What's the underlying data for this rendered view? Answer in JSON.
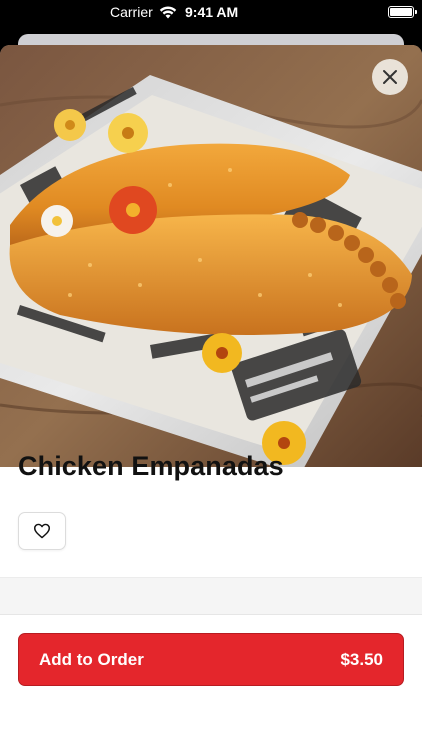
{
  "status_bar": {
    "carrier": "Carrier",
    "time": "9:41 AM"
  },
  "item": {
    "name": "Chicken Empanadas",
    "price": "$3.50",
    "image_icon": "empanada-photo"
  },
  "actions": {
    "add_to_order_label": "Add to Order",
    "favorite_icon": "heart-icon",
    "close_icon": "close-icon"
  },
  "colors": {
    "accent": "#e4262c",
    "title": "#111111"
  }
}
